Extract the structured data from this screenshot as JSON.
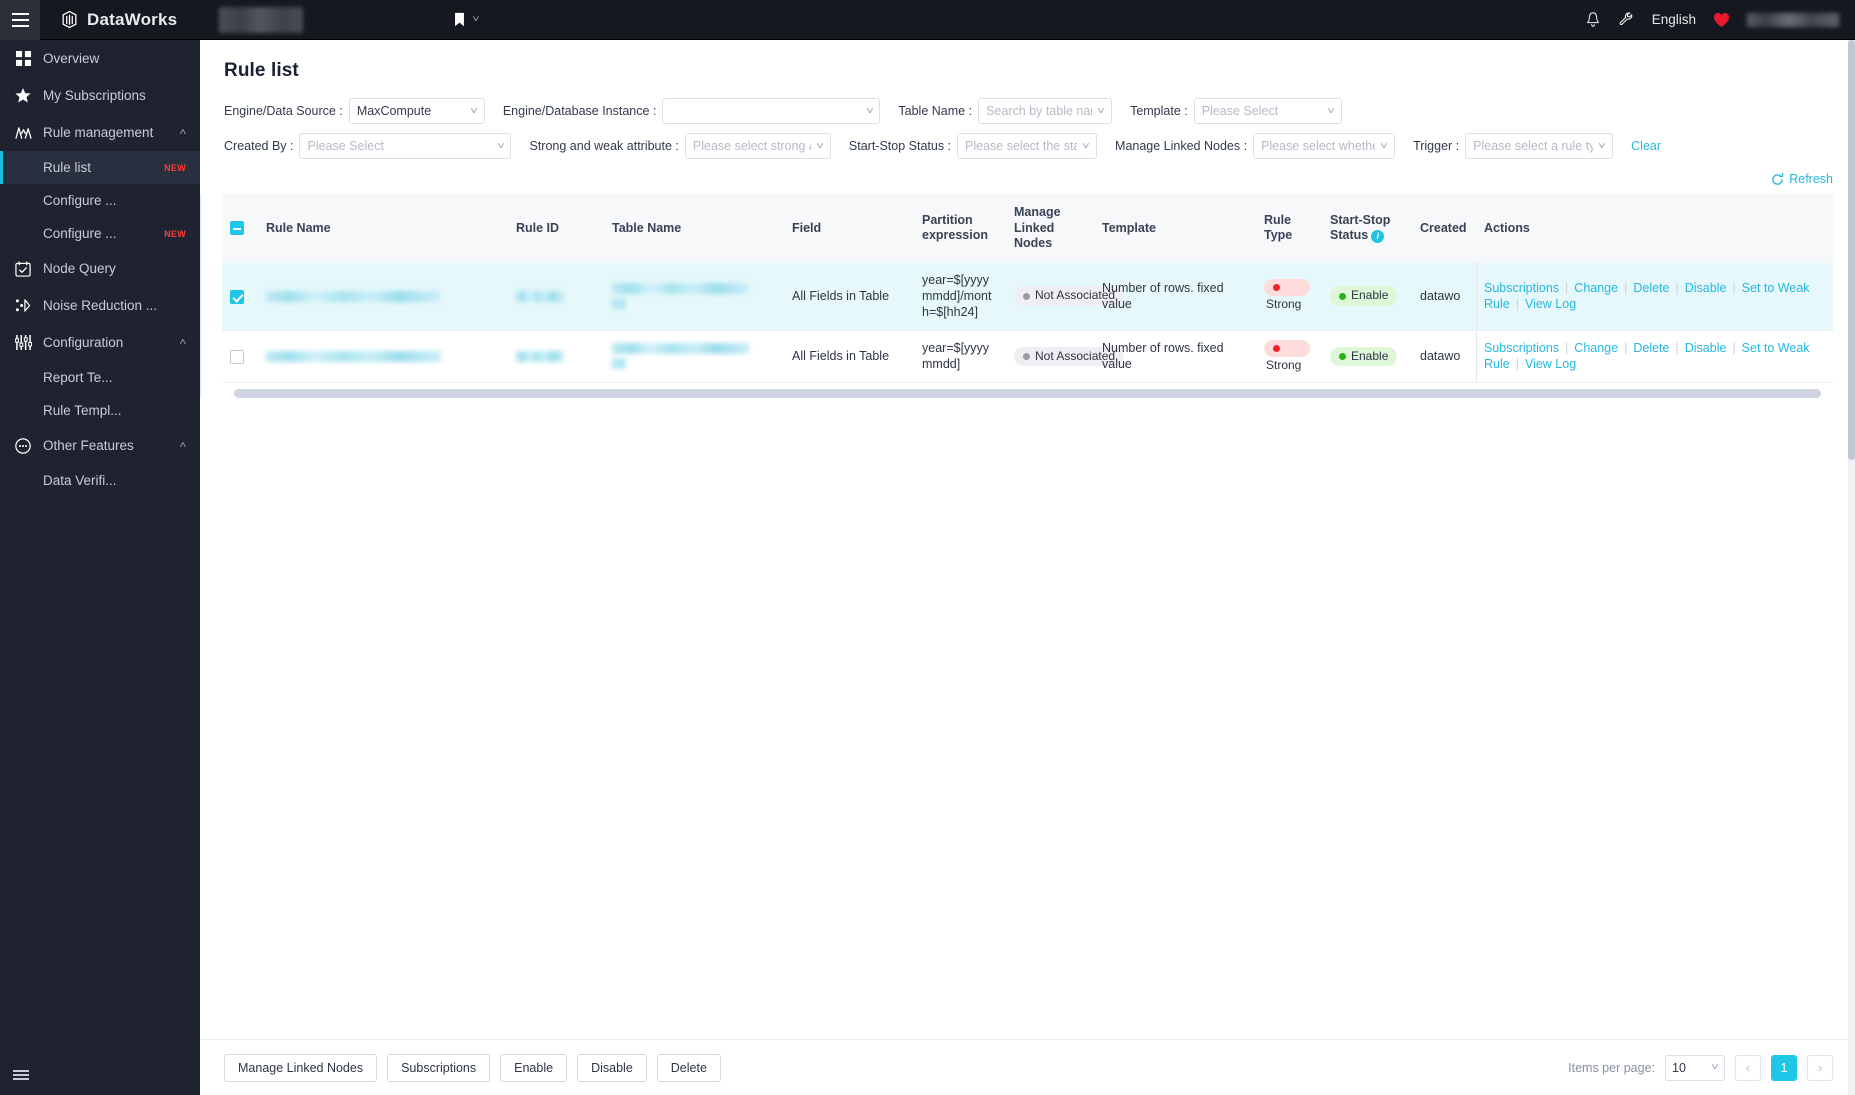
{
  "topbar": {
    "brand": "DataWorks",
    "workspace_redacted": "",
    "bookmark_icon": "bookmark-icon",
    "bell_icon": "notification-bell-icon",
    "wrench_icon": "wrench-icon",
    "language": "English",
    "avatar_icon": "heart-avatar-icon",
    "username_redacted": ""
  },
  "sidebar": {
    "items": [
      {
        "label": "Overview",
        "icon": "grid-icon",
        "type": "item"
      },
      {
        "label": "My Subscriptions",
        "icon": "star-icon",
        "type": "item"
      },
      {
        "label": "Rule management",
        "icon": "wave-icon",
        "type": "group",
        "expanded": true
      },
      {
        "label": "Rule list",
        "type": "sub",
        "active": true,
        "badge": "NEW"
      },
      {
        "label": "Configure ...",
        "type": "sub",
        "active": false,
        "badge": ""
      },
      {
        "label": "Configure ...",
        "type": "sub",
        "active": false,
        "badge": "NEW"
      },
      {
        "label": "Node Query",
        "icon": "calendar-check-icon",
        "type": "item"
      },
      {
        "label": "Noise Reduction ...",
        "icon": "noise-icon",
        "type": "item"
      },
      {
        "label": "Configuration",
        "icon": "sliders-icon",
        "type": "group",
        "expanded": true
      },
      {
        "label": "Report Te...",
        "type": "sub",
        "active": false,
        "badge": ""
      },
      {
        "label": "Rule Templ...",
        "type": "sub",
        "active": false,
        "badge": ""
      },
      {
        "label": "Other Features",
        "icon": "dots-circle-icon",
        "type": "group",
        "expanded": true
      },
      {
        "label": "Data Verifi...",
        "type": "sub",
        "active": false,
        "badge": ""
      }
    ],
    "collapse_icon": "collapse-menu-icon"
  },
  "page": {
    "title": "Rule list"
  },
  "filters": {
    "row1": [
      {
        "label": "Engine/Data Source :",
        "value": "MaxCompute",
        "placeholder": "",
        "redacted": false,
        "width": "w-engine"
      },
      {
        "label": "Engine/Database Instance :",
        "value": "",
        "placeholder": "",
        "redacted": true,
        "width": "w-inst"
      },
      {
        "label": "Table Name :",
        "value": "",
        "placeholder": "Search by table name",
        "redacted": false,
        "width": "w-table"
      },
      {
        "label": "Template :",
        "value": "",
        "placeholder": "Please Select",
        "redacted": false,
        "width": "w-tmpl"
      }
    ],
    "row2": [
      {
        "label": "Created By :",
        "value": "",
        "placeholder": "Please Select",
        "redacted": false,
        "width": "w-created"
      },
      {
        "label": "Strong and weak attribute :",
        "value": "",
        "placeholder": "Please select strong a",
        "redacted": false,
        "width": "w-strong"
      },
      {
        "label": "Start-Stop Status :",
        "value": "",
        "placeholder": "Please select the star",
        "redacted": false,
        "width": "w-status"
      },
      {
        "label": "Manage Linked Nodes :",
        "value": "",
        "placeholder": "Please select whethe",
        "redacted": false,
        "width": "w-linked"
      },
      {
        "label": "Trigger :",
        "value": "",
        "placeholder": "Please select a rule ty",
        "redacted": false,
        "width": "w-trigger"
      }
    ],
    "clear_label": "Clear",
    "refresh_label": "Refresh",
    "refresh_icon": "refresh-icon"
  },
  "table": {
    "columns": [
      "Rule Name",
      "Rule ID",
      "Table Name",
      "Field",
      "Partition expression",
      "Manage Linked Nodes",
      "Template",
      "Rule Type",
      "Start-Stop Status",
      "Created",
      "Actions"
    ],
    "header_select_all_state": "indeterminate",
    "status_info_icon": "info-icon",
    "rows": [
      {
        "selected": true,
        "rule_name": "",
        "rule_id": "",
        "table_name": "",
        "field": "All Fields in Table",
        "partition_expression": "year=$[yyyymmdd]/month=$[hh24]",
        "manage_linked_nodes": "Not Associated",
        "template": "Number of rows. fixed value",
        "rule_type": "Strong",
        "start_stop_status": "Enable",
        "created_by": "datawo",
        "actions": [
          "Subscriptions",
          "Change",
          "Delete",
          "Disable",
          "Set to Weak Rule",
          "View Log"
        ]
      },
      {
        "selected": false,
        "rule_name": "",
        "rule_id": "",
        "table_name": "",
        "field": "All Fields in Table",
        "partition_expression": "year=$[yyyymmdd]",
        "manage_linked_nodes": "Not Associated",
        "template": "Number of rows. fixed value",
        "rule_type": "Strong",
        "start_stop_status": "Enable",
        "created_by": "datawo",
        "actions": [
          "Subscriptions",
          "Change",
          "Delete",
          "Disable",
          "Set to Weak Rule",
          "View Log"
        ]
      }
    ]
  },
  "footer": {
    "buttons": [
      "Manage Linked Nodes",
      "Subscriptions",
      "Enable",
      "Disable",
      "Delete"
    ],
    "items_per_page_label": "Items per page:",
    "items_per_page_value": "10",
    "prev_icon": "chevron-left-icon",
    "next_icon": "chevron-right-icon",
    "current_page": "1"
  },
  "colors": {
    "accent": "#1ec7e6",
    "link": "#27b7e0",
    "sidebar_bg": "#1f2330",
    "topbar_bg": "#16181f",
    "selected_row": "#e6f8fb",
    "strong_red": "#f5222d",
    "enable_green": "#29b318",
    "badge_new": "#ff3b30"
  }
}
